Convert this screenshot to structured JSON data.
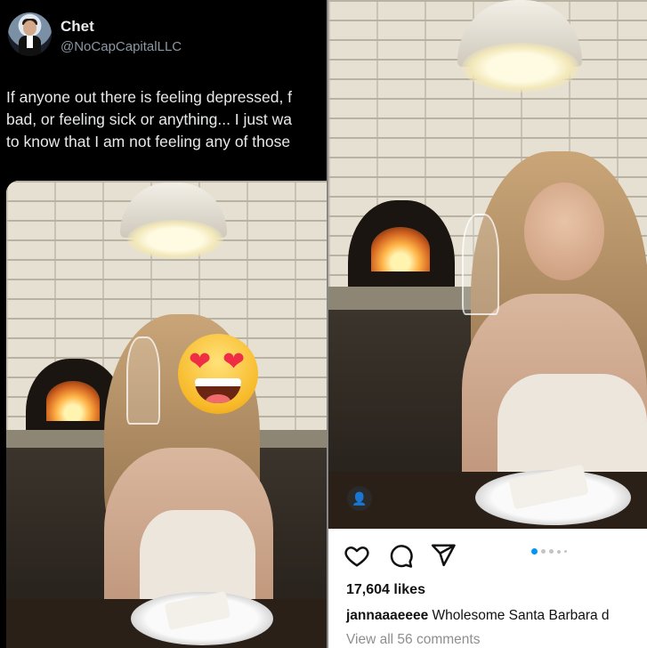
{
  "tweet": {
    "name": "Chet",
    "handle": "@NoCapCapitalLLC",
    "lines": [
      "If anyone out there is feeling depressed, f",
      "bad, or feeling sick or anything... I just wa",
      "to know that I am not feeling any of those"
    ]
  },
  "instagram": {
    "likes": "17,604 likes",
    "username": "jannaaaeeee",
    "caption": "Wholesome Santa Barbara d",
    "view_comments": "View all 56 comments",
    "carousel_dots": 5,
    "active_dot": 0
  },
  "icons": {
    "like": "heart-icon",
    "comment": "comment-icon",
    "share": "send-icon",
    "tag": "user-tag-icon",
    "overlay": "heart-eyes-emoji"
  },
  "colors": {
    "accent_blue": "#0095f6",
    "emoji_yellow": "#f7b928",
    "emoji_heart": "#ef2d44"
  }
}
